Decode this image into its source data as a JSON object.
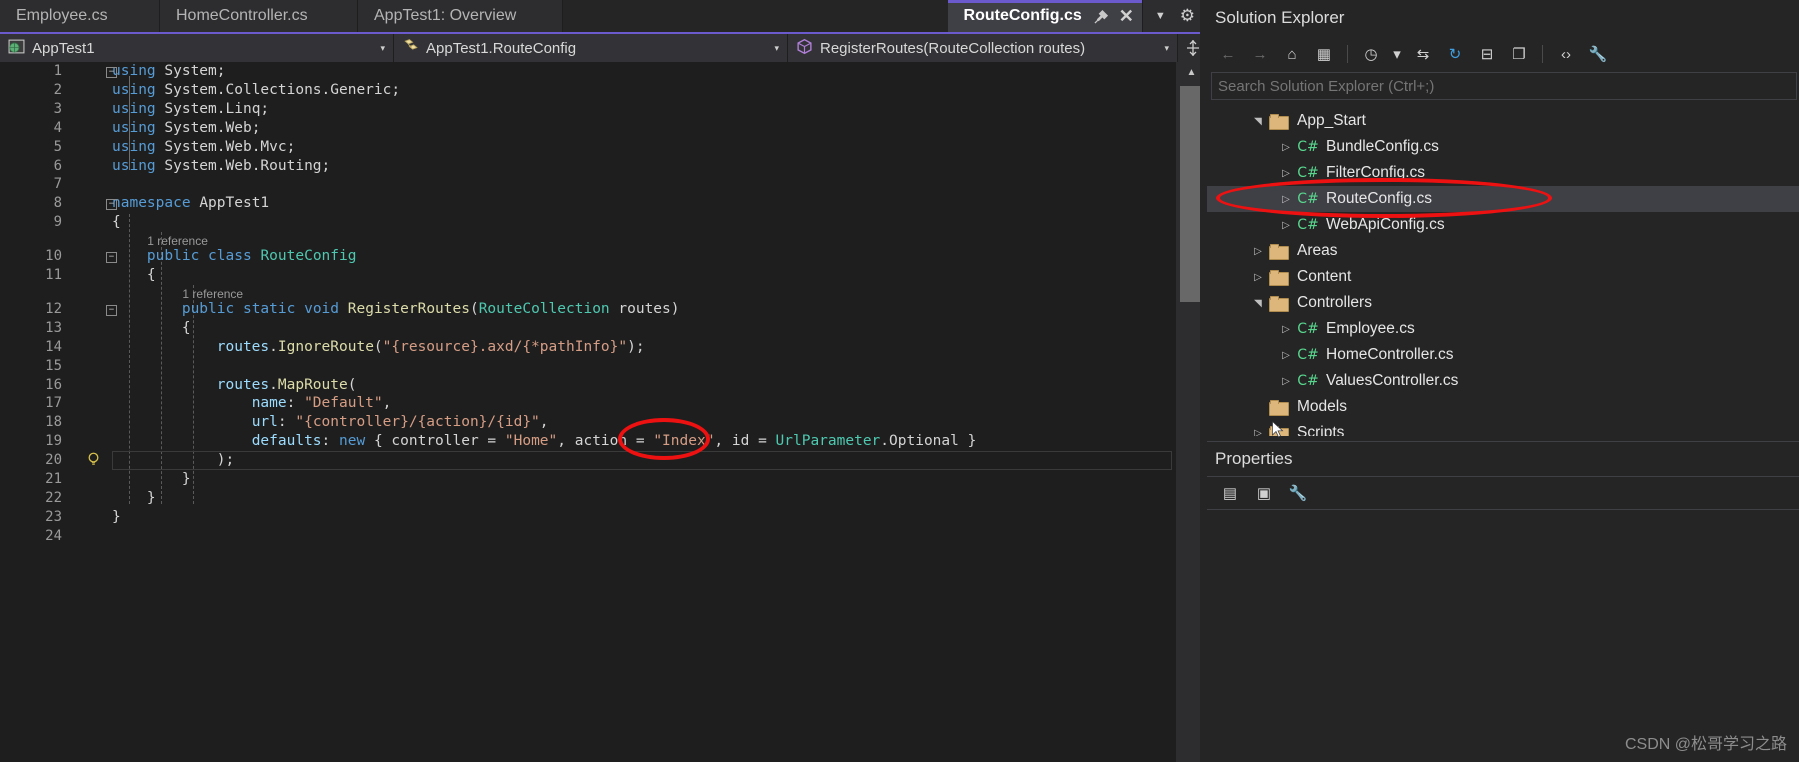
{
  "window": {
    "watermark": "CSDN @松哥学习之路"
  },
  "tabs": {
    "items": [
      {
        "label": "Employee.cs",
        "active": false
      },
      {
        "label": "HomeController.cs",
        "active": false
      },
      {
        "label": "AppTest1: Overview",
        "active": false
      },
      {
        "label": "RouteConfig.cs",
        "active": true
      }
    ],
    "pin_icon": "pin-icon",
    "close_icon": "close-icon",
    "overflow_icon": "chevron-down-icon",
    "settings_icon": "gear-icon"
  },
  "navbar": {
    "project": "AppTest1",
    "type": "AppTest1.RouteConfig",
    "member": "RegisterRoutes(RouteCollection routes)",
    "project_icon": "project-globe-icon",
    "type_icon": "class-icon",
    "member_icon": "method-cube-icon",
    "caret": "▾",
    "split_icon": "split-view-icon"
  },
  "editor": {
    "current_line": 20,
    "lines": [
      {
        "n": "1",
        "fold": "minus",
        "text_html": "<span class=\"kw\">using</span> <span class=\"pln\">System;</span>"
      },
      {
        "n": "2",
        "fold": "",
        "text_html": "<span class=\"kw\">using</span> <span class=\"pln\">System.Collections.Generic;</span>"
      },
      {
        "n": "3",
        "fold": "",
        "text_html": "<span class=\"kw\">using</span> <span class=\"pln\">System.Linq;</span>"
      },
      {
        "n": "4",
        "fold": "",
        "text_html": "<span class=\"kw\">using</span> <span class=\"pln\">System.Web;</span>"
      },
      {
        "n": "5",
        "fold": "",
        "text_html": "<span class=\"kw\">using</span> <span class=\"pln\">System.Web.Mvc;</span>"
      },
      {
        "n": "6",
        "fold": "",
        "text_html": "<span class=\"kw\">using</span> <span class=\"pln\">System.Web.Routing;</span>"
      },
      {
        "n": "7",
        "fold": "",
        "text_html": ""
      },
      {
        "n": "8",
        "fold": "minus",
        "text_html": "<span class=\"kw\">namespace</span> <span class=\"pln\">AppTest1</span>"
      },
      {
        "n": "9",
        "fold": "",
        "text_html": "<span class=\"pln\">{</span>"
      },
      {
        "n": "",
        "fold": "",
        "lens": "1 reference",
        "indent": 4
      },
      {
        "n": "10",
        "fold": "minus",
        "text_html": "    <span class=\"kw\">public</span> <span class=\"kw\">class</span> <span class=\"typ\">RouteConfig</span>"
      },
      {
        "n": "11",
        "fold": "",
        "text_html": "    <span class=\"pln\">{</span>"
      },
      {
        "n": "",
        "fold": "",
        "lens": "1 reference",
        "indent": 8
      },
      {
        "n": "12",
        "fold": "minus",
        "text_html": "        <span class=\"kw\">public</span> <span class=\"kw\">static</span> <span class=\"kw\">void</span> <span class=\"mth\">RegisterRoutes</span><span class=\"pln\">(</span><span class=\"typ\">RouteCollection</span> <span class=\"pln\">routes)</span>"
      },
      {
        "n": "13",
        "fold": "",
        "text_html": "        <span class=\"pln\">{</span>"
      },
      {
        "n": "14",
        "fold": "",
        "text_html": "            <span class=\"id\">routes</span><span class=\"pln\">.</span><span class=\"mth\">IgnoreRoute</span><span class=\"pln\">(</span><span class=\"str\">\"{resource}.axd/{*pathInfo}\"</span><span class=\"pln\">);</span>"
      },
      {
        "n": "15",
        "fold": "",
        "text_html": ""
      },
      {
        "n": "16",
        "fold": "",
        "text_html": "            <span class=\"id\">routes</span><span class=\"pln\">.</span><span class=\"mth\">MapRoute</span><span class=\"pln\">(</span>"
      },
      {
        "n": "17",
        "fold": "",
        "text_html": "                <span class=\"id\">name</span><span class=\"pln\">: </span><span class=\"str\">\"Default\"</span><span class=\"pln\">,</span>"
      },
      {
        "n": "18",
        "fold": "",
        "text_html": "                <span class=\"id\">url</span><span class=\"pln\">: </span><span class=\"str\">\"{controller}/{action}/{id}\"</span><span class=\"pln\">,</span>"
      },
      {
        "n": "19",
        "fold": "",
        "text_html": "                <span class=\"id\">defaults</span><span class=\"pln\">: </span><span class=\"kw\">new</span> <span class=\"pln\">{ controller = </span><span class=\"str\">\"Home\"</span><span class=\"pln\">, action = </span><span class=\"str\">\"Index\"</span><span class=\"pln\">, id = </span><span class=\"typ\">UrlParameter</span><span class=\"pln\">.Optional }</span>"
      },
      {
        "n": "20",
        "fold": "",
        "bulb": true,
        "text_html": "            <span class=\"pln\">);</span>"
      },
      {
        "n": "21",
        "fold": "",
        "text_html": "        <span class=\"pln\">}</span>"
      },
      {
        "n": "22",
        "fold": "",
        "text_html": "    <span class=\"pln\">}</span>"
      },
      {
        "n": "23",
        "fold": "",
        "text_html": "<span class=\"pln\">}</span>"
      },
      {
        "n": "24",
        "fold": "",
        "text_html": ""
      }
    ],
    "scroll_up_icon": "scroll-up-arrow-icon"
  },
  "solution_explorer": {
    "title": "Solution Explorer",
    "toolbar": [
      {
        "name": "back-button",
        "glyph": "←",
        "dim": true
      },
      {
        "name": "forward-button",
        "glyph": "→",
        "dim": true
      },
      {
        "name": "home-button",
        "glyph": "⌂",
        "dim": false
      },
      {
        "name": "switch-views-button",
        "glyph": "▦",
        "dim": false
      },
      {
        "name": "pending-changes-button",
        "glyph": "◷",
        "dim": false
      },
      {
        "name": "pending-changes-dropdown",
        "glyph": "▾",
        "dim": false
      },
      {
        "name": "sync-with-active-document-button",
        "glyph": "⇆",
        "dim": false
      },
      {
        "name": "refresh-button",
        "glyph": "↻",
        "dim": false
      },
      {
        "name": "collapse-all-button",
        "glyph": "⊟",
        "dim": false
      },
      {
        "name": "show-all-files-button",
        "glyph": "❐",
        "dim": false
      },
      {
        "name": "view-code-button",
        "glyph": "‹›",
        "dim": false
      },
      {
        "name": "properties-button",
        "glyph": "🔧",
        "dim": false
      }
    ],
    "search_placeholder": "Search Solution Explorer (Ctrl+;)",
    "search_value": "",
    "tree": [
      {
        "label": "App_Start",
        "kind": "folder",
        "state": "expanded",
        "indent": 1,
        "highlighted": false
      },
      {
        "label": "BundleConfig.cs",
        "kind": "cs",
        "state": "collapsed",
        "indent": 2,
        "highlighted": false
      },
      {
        "label": "FilterConfig.cs",
        "kind": "cs",
        "state": "collapsed",
        "indent": 2,
        "highlighted": false
      },
      {
        "label": "RouteConfig.cs",
        "kind": "cs",
        "state": "collapsed",
        "indent": 2,
        "highlighted": true
      },
      {
        "label": "WebApiConfig.cs",
        "kind": "cs",
        "state": "collapsed",
        "indent": 2,
        "highlighted": false
      },
      {
        "label": "Areas",
        "kind": "folder",
        "state": "collapsed",
        "indent": 1,
        "highlighted": false
      },
      {
        "label": "Content",
        "kind": "folder",
        "state": "collapsed",
        "indent": 1,
        "highlighted": false
      },
      {
        "label": "Controllers",
        "kind": "folder",
        "state": "expanded",
        "indent": 1,
        "highlighted": false
      },
      {
        "label": "Employee.cs",
        "kind": "cs",
        "state": "collapsed",
        "indent": 2,
        "highlighted": false
      },
      {
        "label": "HomeController.cs",
        "kind": "cs",
        "state": "collapsed",
        "indent": 2,
        "highlighted": false
      },
      {
        "label": "ValuesController.cs",
        "kind": "cs",
        "state": "collapsed",
        "indent": 2,
        "highlighted": false
      },
      {
        "label": "Models",
        "kind": "folder",
        "state": "none",
        "indent": 1,
        "highlighted": false
      },
      {
        "label": "Scripts",
        "kind": "folder",
        "state": "collapsed",
        "indent": 1,
        "highlighted": false
      }
    ]
  },
  "properties": {
    "title": "Properties",
    "toolbar": [
      {
        "name": "categorized-button",
        "glyph": "▤"
      },
      {
        "name": "alphabetical-button",
        "glyph": "▣"
      },
      {
        "name": "properties-wrench-button",
        "glyph": "🔧"
      }
    ]
  },
  "colors": {
    "accent_purple": "#6a5acd",
    "annotation_red": "#ee1111",
    "editor_bg": "#1e1e1e",
    "chrome_bg": "#2d2d30",
    "keyword_blue": "#569cd6",
    "type_teal": "#4ec9b0",
    "string_orange": "#d69d85",
    "method_yellow": "#dcdcaa",
    "identifier_lightblue": "#9cdcfe",
    "folder_tan": "#dcb67a",
    "cs_green": "#58d68d"
  }
}
